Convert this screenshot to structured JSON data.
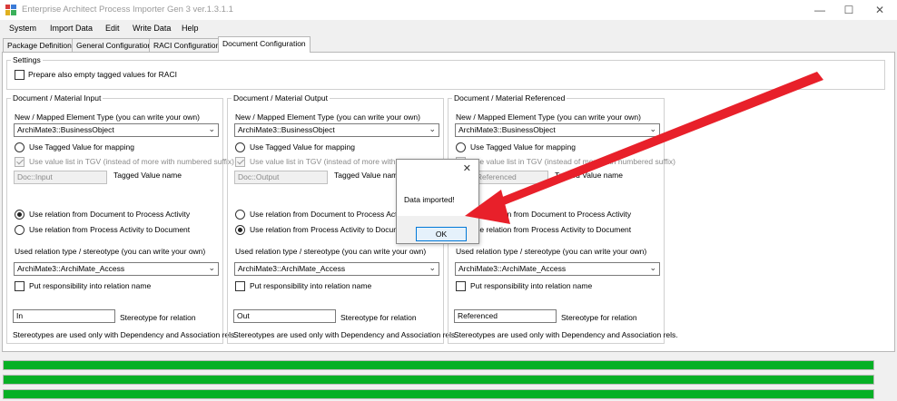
{
  "window": {
    "title": "Enterprise Architect Process Importer Gen 3 ver.1.3.1.1",
    "minimize": "—",
    "maximize": "☐",
    "close": "✕"
  },
  "menu": [
    "System",
    "Import Data",
    "Edit",
    "Write Data",
    "Help"
  ],
  "tabs": [
    "Package Definition",
    "General Configuration",
    "RACI Configuration",
    "Document Configuration"
  ],
  "active_tab": "Document Configuration",
  "settings": {
    "legend": "Settings",
    "empty_tagged_label": "Prepare also empty tagged values for RACI"
  },
  "columns": [
    {
      "legend": "Document / Material Input",
      "element_type_label": "New / Mapped Element Type (you can write your own)",
      "element_type_value": "ArchiMate3::BusinessObject",
      "use_tagged_label": "Use Tagged Value for mapping",
      "value_list_label": "Use value list in TGV (instead of more with numbered suffix)",
      "tagged_value": "Doc::Input",
      "tagged_name_label": "Tagged Value name",
      "rel_doc_to_proc": "Use relation from Document to Process Activity",
      "rel_proc_to_doc": "Use relation from Process Activity to Document",
      "rel_type_label": "Used relation type / stereotype (you can write your own)",
      "rel_type_value": "ArchiMate3::ArchiMate_Access",
      "responsibility_label": "Put responsibility into relation name",
      "stereotype_value": "In",
      "stereotype_label": "Stereotype for relation",
      "footer_note": "Stereotypes are used only with Dependency and Association rels."
    },
    {
      "legend": "Document / Material Output",
      "element_type_label": "New / Mapped Element Type (you can write your own)",
      "element_type_value": "ArchiMate3::BusinessObject",
      "use_tagged_label": "Use Tagged Value for mapping",
      "value_list_label": "Use value list in TGV (instead of more with numbered suffix)",
      "tagged_value": "Doc::Output",
      "tagged_name_label": "Tagged Value name",
      "rel_doc_to_proc": "Use relation from Document to Process Activity",
      "rel_proc_to_doc": "Use relation from Process Activity to Document",
      "rel_type_label": "Used relation type / stereotype (you can write your own)",
      "rel_type_value": "ArchiMate3::ArchiMate_Access",
      "responsibility_label": "Put responsibility into relation name",
      "stereotype_value": "Out",
      "stereotype_label": "Stereotype for relation",
      "footer_note": "Stereotypes are used only with Dependency and Association rels."
    },
    {
      "legend": "Document / Material Referenced",
      "element_type_label": "New / Mapped Element Type (you can write your own)",
      "element_type_value": "ArchiMate3::BusinessObject",
      "use_tagged_label": "Use Tagged Value for mapping",
      "value_list_label": "Use value list in TGV (instead of more with numbered suffix)",
      "tagged_value": "Doc::Referenced",
      "tagged_name_label": "Tagged Value name",
      "rel_doc_to_proc": "Use relation from Document to Process Activity",
      "rel_proc_to_doc": "Use relation from Process Activity to Document",
      "rel_type_label": "Used relation type / stereotype (you can write your own)",
      "rel_type_value": "ArchiMate3::ArchiMate_Access",
      "responsibility_label": "Put responsibility into relation name",
      "stereotype_value": "Referenced",
      "stereotype_label": "Stereotype for relation",
      "footer_note": "Stereotypes are used only with Dependency and Association rels."
    }
  ],
  "progress_bars": [
    1.0,
    1.0,
    1.0
  ],
  "dialog": {
    "message": "Data imported!",
    "ok_label": "OK",
    "close": "✕"
  },
  "colors": {
    "progress_fill": "#06b025",
    "annotation_arrow": "#e8202a"
  }
}
